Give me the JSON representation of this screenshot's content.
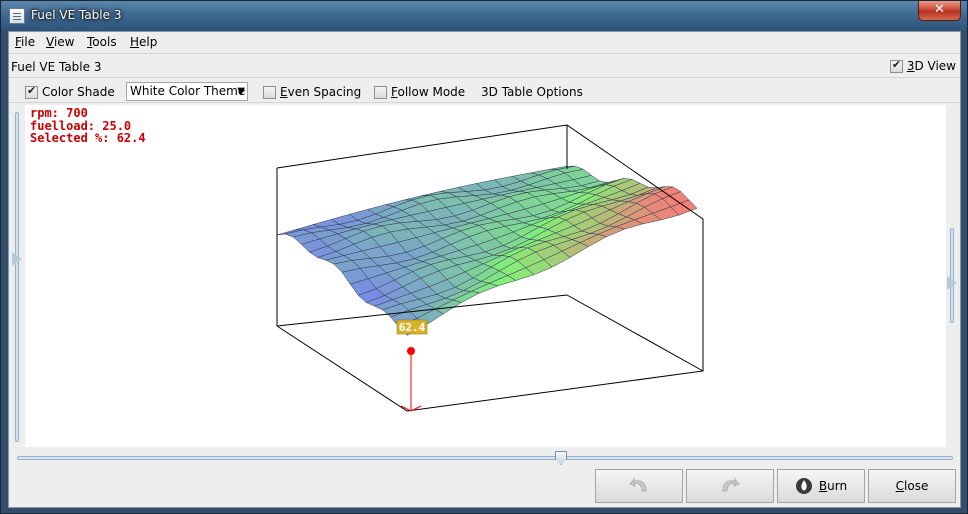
{
  "window": {
    "title": "Fuel VE Table 3",
    "close_glyph": "✕"
  },
  "menu": {
    "items": [
      {
        "label": "File",
        "mnemonic": "F",
        "rest": "ile"
      },
      {
        "label": "View",
        "mnemonic": "V",
        "rest": "iew"
      },
      {
        "label": "Tools",
        "mnemonic": "T",
        "rest": "ools"
      },
      {
        "label": "Help",
        "mnemonic": "H",
        "rest": "elp"
      }
    ]
  },
  "header": {
    "table_name": "Fuel VE Table 3",
    "view3d_label": "3D View",
    "view3d_mnemonic": "3",
    "view3d_rest": "D View",
    "view3d_checked": true
  },
  "options": {
    "color_shade": {
      "label": "Color Shade",
      "checked": true
    },
    "theme": {
      "value": "White Color Theme"
    },
    "even_spacing": {
      "label": "Even Spacing",
      "mnemonic": "E",
      "rest": "ven Spacing",
      "checked": false
    },
    "follow_mode": {
      "label": "Follow Mode",
      "mnemonic": "F",
      "rest": "ollow Mode",
      "checked": false
    },
    "table_options_label": "3D Table Options"
  },
  "readout": {
    "rpm": "rpm: 700",
    "fuelload": "fuelload: 25.0",
    "selected": "Selected %: 62.4",
    "cursor_value": "62.4"
  },
  "buttons": {
    "undo": {
      "icon": "undo-arrow-icon"
    },
    "redo": {
      "icon": "redo-arrow-icon"
    },
    "burn": {
      "label": "Burn",
      "mnemonic": "B",
      "rest": "urn",
      "icon": "burn-flame-icon"
    },
    "close": {
      "label": "Close",
      "mnemonic": "C",
      "rest": "lose"
    }
  },
  "colors": {
    "readout": "#cc0000",
    "cursor_label_bg": "#d7b32c"
  }
}
